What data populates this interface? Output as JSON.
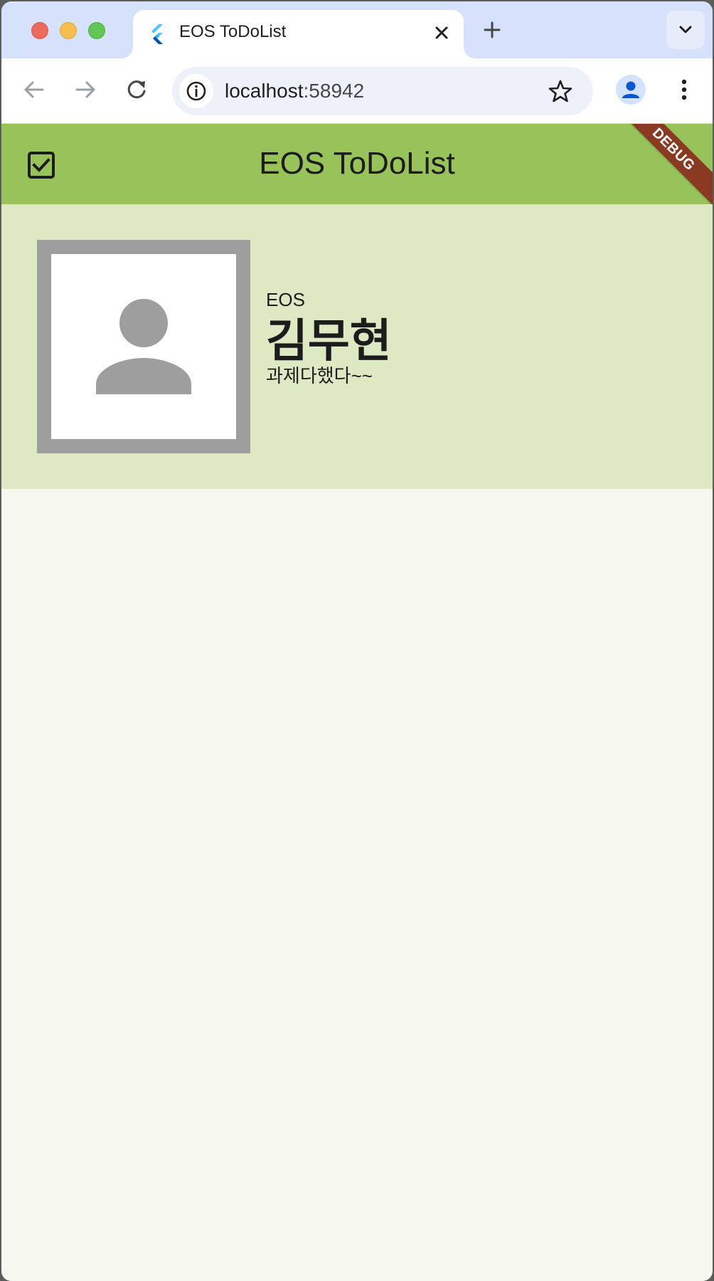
{
  "browser": {
    "tab": {
      "title": "EOS ToDoList",
      "favicon": "flutter-logo-icon"
    },
    "address_bar": {
      "host": "localhost",
      "port": ":58942"
    }
  },
  "app": {
    "appbar": {
      "title": "EOS ToDoList",
      "leading_icon": "checkbox-checked-icon",
      "background": "#98c35b"
    },
    "debug_banner": "DEBUG",
    "profile": {
      "avatar_icon": "person-icon",
      "organization": "EOS",
      "name": "김무현",
      "status": "과제다했다~~",
      "card_background": "#dce9c2"
    }
  }
}
